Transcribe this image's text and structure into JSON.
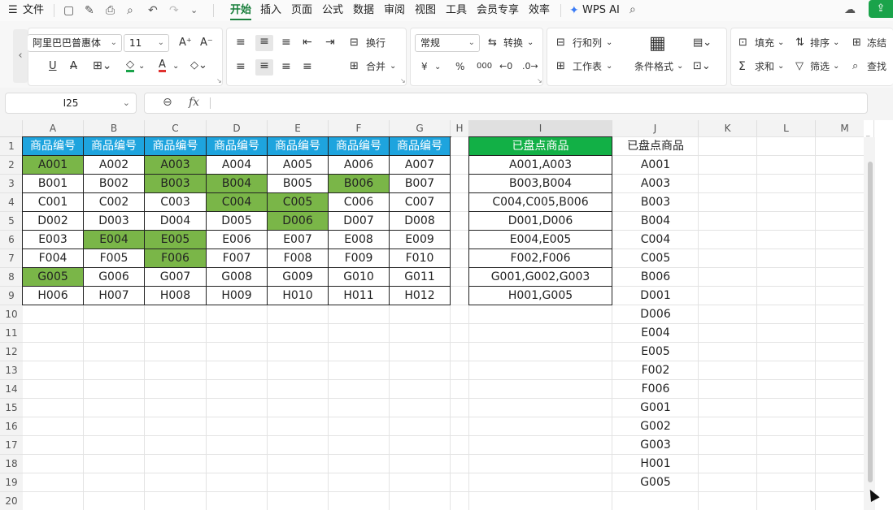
{
  "menubar": {
    "file": "文件",
    "tabs": [
      "开始",
      "插入",
      "页面",
      "公式",
      "数据",
      "审阅",
      "视图",
      "工具",
      "会员专享",
      "效率"
    ],
    "active_tab": "开始",
    "wps_ai": "WPS AI"
  },
  "ribbon": {
    "font_name": "阿里巴巴普惠体",
    "font_size": "11",
    "wrap": "换行",
    "merge": "合并",
    "number_format": "常规",
    "convert": "转换",
    "row_col": "行和列",
    "worksheet": "工作表",
    "cond_format": "条件格式",
    "fill": "填充",
    "sort": "排序",
    "freeze": "冻结",
    "sum": "求和",
    "filter": "筛选",
    "find": "查找",
    "yen": "¥",
    "percent": "%",
    "thousands": "000"
  },
  "formula_bar": {
    "cell_ref": "I25",
    "fx": "fx",
    "content": ""
  },
  "sheet": {
    "columns": [
      "A",
      "B",
      "C",
      "D",
      "E",
      "F",
      "G",
      "H",
      "I",
      "J",
      "K",
      "L",
      "M"
    ],
    "selected_column": "I",
    "row_numbers": [
      "1",
      "2",
      "3",
      "4",
      "5",
      "6",
      "7",
      "8",
      "9",
      "10",
      "11",
      "12",
      "13",
      "14",
      "15",
      "16",
      "17",
      "18",
      "19",
      "20"
    ],
    "header_row": [
      "商品编号",
      "商品编号",
      "商品编号",
      "商品编号",
      "商品编号",
      "商品编号",
      "商品编号"
    ],
    "table": [
      [
        "A001",
        "A002",
        "A003",
        "A004",
        "A005",
        "A006",
        "A007"
      ],
      [
        "B001",
        "B002",
        "B003",
        "B004",
        "B005",
        "B006",
        "B007"
      ],
      [
        "C001",
        "C002",
        "C003",
        "C004",
        "C005",
        "C006",
        "C007"
      ],
      [
        "D002",
        "D003",
        "D004",
        "D005",
        "D006",
        "D007",
        "D008"
      ],
      [
        "E003",
        "E004",
        "E005",
        "E006",
        "E007",
        "E008",
        "E009"
      ],
      [
        "F004",
        "F005",
        "F006",
        "F007",
        "F008",
        "F009",
        "F010"
      ],
      [
        "G005",
        "G006",
        "G007",
        "G008",
        "G009",
        "G010",
        "G011"
      ],
      [
        "H006",
        "H007",
        "H008",
        "H009",
        "H010",
        "H011",
        "H012"
      ]
    ],
    "highlighted": [
      "A001",
      "A003",
      "B003",
      "B004",
      "B006",
      "C004",
      "C005",
      "D006",
      "E004",
      "E005",
      "F006",
      "G005"
    ],
    "highlight_color": "#7ab648",
    "header_color": "#1ea4de",
    "summary_header": "已盘点商品",
    "summary_header_color": "#12b046",
    "summary": [
      "A001,A003",
      "B003,B004",
      "C004,C005,B006",
      "D001,D006",
      "E004,E005",
      "F002,F006",
      "G001,G002,G003",
      "H001,G005"
    ],
    "list_header": "已盘点商品",
    "list": [
      "A001",
      "A003",
      "B003",
      "B004",
      "C004",
      "C005",
      "B006",
      "D001",
      "D006",
      "E004",
      "E005",
      "F002",
      "F006",
      "G001",
      "G002",
      "G003",
      "H001",
      "G005"
    ]
  }
}
